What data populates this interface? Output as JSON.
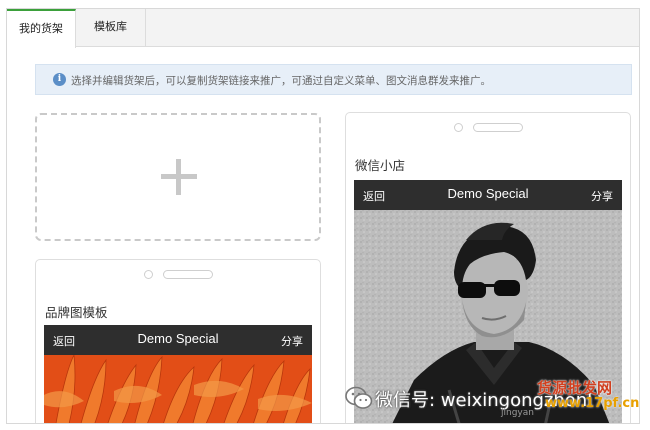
{
  "tabs": [
    {
      "label": "我的货架",
      "active": true
    },
    {
      "label": "模板库",
      "active": false
    }
  ],
  "notice": {
    "icon": "info-icon",
    "text": "选择并编辑货架后，可以复制货架链接来推广，可通过自定义菜单、图文消息群发来推广。"
  },
  "add_card": {
    "icon": "plus-icon"
  },
  "cards": [
    {
      "title": "微信小店",
      "appbar": {
        "back": "返回",
        "title": "Demo Special",
        "share": "分享"
      },
      "image": "man-in-sunglasses-photo"
    },
    {
      "title": "品牌图模板",
      "appbar": {
        "back": "返回",
        "title": "Demo Special",
        "share": "分享"
      },
      "image": "orange-flower-photo"
    }
  ],
  "watermark": {
    "text": "微信号: weixingongzhonl",
    "sub": "jingyan",
    "site": "货源批发网",
    "url": "www.17pf.cn"
  },
  "colors": {
    "accent": "#3ba03b",
    "notice_bg": "#e7eff8",
    "info": "#5b8ec7",
    "appbar": "#2e2e2e",
    "flower": "#e8511a"
  }
}
